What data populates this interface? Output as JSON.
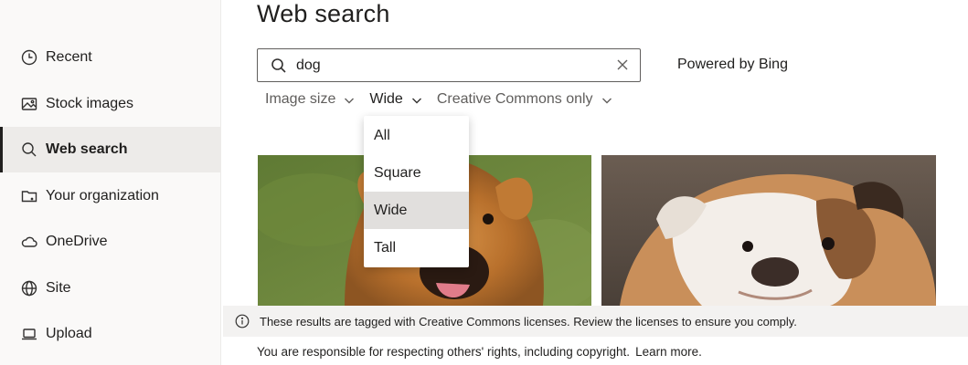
{
  "sidebar": {
    "items": [
      {
        "label": "Recent",
        "icon": "clock-icon",
        "active": false
      },
      {
        "label": "Stock images",
        "icon": "image-icon",
        "active": false
      },
      {
        "label": "Web search",
        "icon": "search-icon",
        "active": true
      },
      {
        "label": "Your organization",
        "icon": "folder-icon",
        "active": false
      },
      {
        "label": "OneDrive",
        "icon": "cloud-icon",
        "active": false
      },
      {
        "label": "Site",
        "icon": "globe-icon",
        "active": false
      },
      {
        "label": "Upload",
        "icon": "laptop-icon",
        "active": false
      }
    ]
  },
  "main": {
    "title": "Web search",
    "search": {
      "value": "dog",
      "placeholder": ""
    },
    "powered_by": "Powered by Bing",
    "filters": [
      {
        "label": "Image size"
      },
      {
        "label": "Wide"
      },
      {
        "label": "Creative Commons only"
      }
    ],
    "dropdown": {
      "options": [
        "All",
        "Square",
        "Wide",
        "Tall"
      ],
      "selected": "Wide"
    },
    "info": "These results are tagged with Creative Commons licenses. Review the licenses to ensure you comply.",
    "footer": {
      "text": "You are responsible for respecting others' rights, including copyright.",
      "link": "Learn more."
    }
  },
  "colors": {
    "sidebar_bg": "#faf9f8",
    "active_bg": "#edebe9",
    "dropdown_active_bg": "#e1dfdd",
    "info_bar_bg": "#f3f2f1",
    "text": "#201f1e",
    "muted_text": "#605e5c"
  }
}
